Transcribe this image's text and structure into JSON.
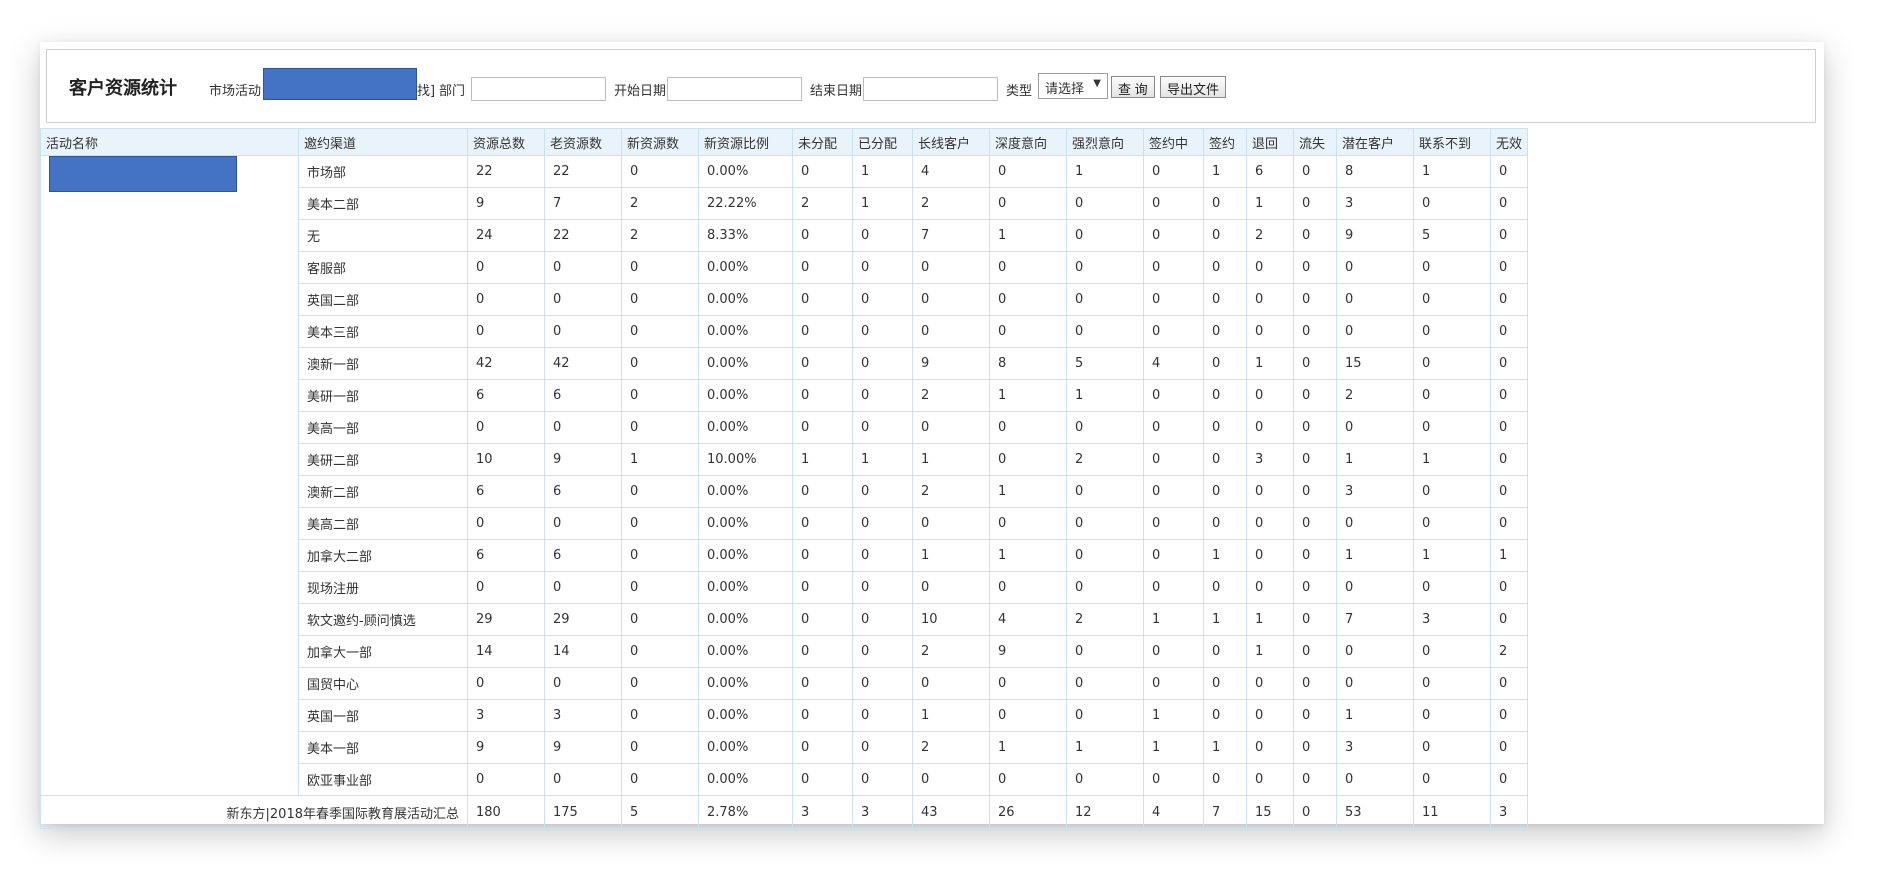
{
  "header": {
    "title": "客户资源统计",
    "filters": {
      "activity_label": "市场活动",
      "activity_suffix": "找]",
      "department_label": "部门",
      "start_date_label": "开始日期",
      "end_date_label": "结束日期",
      "type_label": "类型",
      "type_selected": "请选择",
      "search_button": "查 询",
      "export_button": "导出文件",
      "redaction_color": "#4472c4"
    }
  },
  "table": {
    "columns": [
      "活动名称",
      "邀约渠道",
      "资源总数",
      "老资源数",
      "新资源数",
      "新资源比例",
      "未分配",
      "已分配",
      "长线客户",
      "深度意向",
      "强烈意向",
      "签约中",
      "签约",
      "退回",
      "流失",
      "潜在客户",
      "联系不到",
      "无效"
    ],
    "rows": [
      [
        "市场部",
        "22",
        "22",
        "0",
        "0.00%",
        "0",
        "1",
        "4",
        "0",
        "1",
        "0",
        "1",
        "6",
        "0",
        "8",
        "1",
        "0"
      ],
      [
        "美本二部",
        "9",
        "7",
        "2",
        "22.22%",
        "2",
        "1",
        "2",
        "0",
        "0",
        "0",
        "0",
        "1",
        "0",
        "3",
        "0",
        "0"
      ],
      [
        "无",
        "24",
        "22",
        "2",
        "8.33%",
        "0",
        "0",
        "7",
        "1",
        "0",
        "0",
        "0",
        "2",
        "0",
        "9",
        "5",
        "0"
      ],
      [
        "客服部",
        "0",
        "0",
        "0",
        "0.00%",
        "0",
        "0",
        "0",
        "0",
        "0",
        "0",
        "0",
        "0",
        "0",
        "0",
        "0",
        "0"
      ],
      [
        "英国二部",
        "0",
        "0",
        "0",
        "0.00%",
        "0",
        "0",
        "0",
        "0",
        "0",
        "0",
        "0",
        "0",
        "0",
        "0",
        "0",
        "0"
      ],
      [
        "美本三部",
        "0",
        "0",
        "0",
        "0.00%",
        "0",
        "0",
        "0",
        "0",
        "0",
        "0",
        "0",
        "0",
        "0",
        "0",
        "0",
        "0"
      ],
      [
        "澳新一部",
        "42",
        "42",
        "0",
        "0.00%",
        "0",
        "0",
        "9",
        "8",
        "5",
        "4",
        "0",
        "1",
        "0",
        "15",
        "0",
        "0"
      ],
      [
        "美研一部",
        "6",
        "6",
        "0",
        "0.00%",
        "0",
        "0",
        "2",
        "1",
        "1",
        "0",
        "0",
        "0",
        "0",
        "2",
        "0",
        "0"
      ],
      [
        "美高一部",
        "0",
        "0",
        "0",
        "0.00%",
        "0",
        "0",
        "0",
        "0",
        "0",
        "0",
        "0",
        "0",
        "0",
        "0",
        "0",
        "0"
      ],
      [
        "美研二部",
        "10",
        "9",
        "1",
        "10.00%",
        "1",
        "1",
        "1",
        "0",
        "2",
        "0",
        "0",
        "3",
        "0",
        "1",
        "1",
        "0"
      ],
      [
        "澳新二部",
        "6",
        "6",
        "0",
        "0.00%",
        "0",
        "0",
        "2",
        "1",
        "0",
        "0",
        "0",
        "0",
        "0",
        "3",
        "0",
        "0"
      ],
      [
        "美高二部",
        "0",
        "0",
        "0",
        "0.00%",
        "0",
        "0",
        "0",
        "0",
        "0",
        "0",
        "0",
        "0",
        "0",
        "0",
        "0",
        "0"
      ],
      [
        "加拿大二部",
        "6",
        "6",
        "0",
        "0.00%",
        "0",
        "0",
        "1",
        "1",
        "0",
        "0",
        "1",
        "0",
        "0",
        "1",
        "1",
        "1"
      ],
      [
        "现场注册",
        "0",
        "0",
        "0",
        "0.00%",
        "0",
        "0",
        "0",
        "0",
        "0",
        "0",
        "0",
        "0",
        "0",
        "0",
        "0",
        "0"
      ],
      [
        "软文邀约-顾问慎选",
        "29",
        "29",
        "0",
        "0.00%",
        "0",
        "0",
        "10",
        "4",
        "2",
        "1",
        "1",
        "1",
        "0",
        "7",
        "3",
        "0"
      ],
      [
        "加拿大一部",
        "14",
        "14",
        "0",
        "0.00%",
        "0",
        "0",
        "2",
        "9",
        "0",
        "0",
        "0",
        "1",
        "0",
        "0",
        "0",
        "2"
      ],
      [
        "国贸中心",
        "0",
        "0",
        "0",
        "0.00%",
        "0",
        "0",
        "0",
        "0",
        "0",
        "0",
        "0",
        "0",
        "0",
        "0",
        "0",
        "0"
      ],
      [
        "英国一部",
        "3",
        "3",
        "0",
        "0.00%",
        "0",
        "0",
        "1",
        "0",
        "0",
        "1",
        "0",
        "0",
        "0",
        "1",
        "0",
        "0"
      ],
      [
        "美本一部",
        "9",
        "9",
        "0",
        "0.00%",
        "0",
        "0",
        "2",
        "1",
        "1",
        "1",
        "1",
        "0",
        "0",
        "3",
        "0",
        "0"
      ],
      [
        "欧亚事业部",
        "0",
        "0",
        "0",
        "0.00%",
        "0",
        "0",
        "0",
        "0",
        "0",
        "0",
        "0",
        "0",
        "0",
        "0",
        "0",
        "0"
      ]
    ],
    "total": {
      "name": "新东方|2018年春季国际教育展活动汇总",
      "values": [
        "180",
        "175",
        "5",
        "2.78%",
        "3",
        "3",
        "43",
        "26",
        "12",
        "4",
        "7",
        "15",
        "0",
        "53",
        "11",
        "3"
      ]
    }
  }
}
